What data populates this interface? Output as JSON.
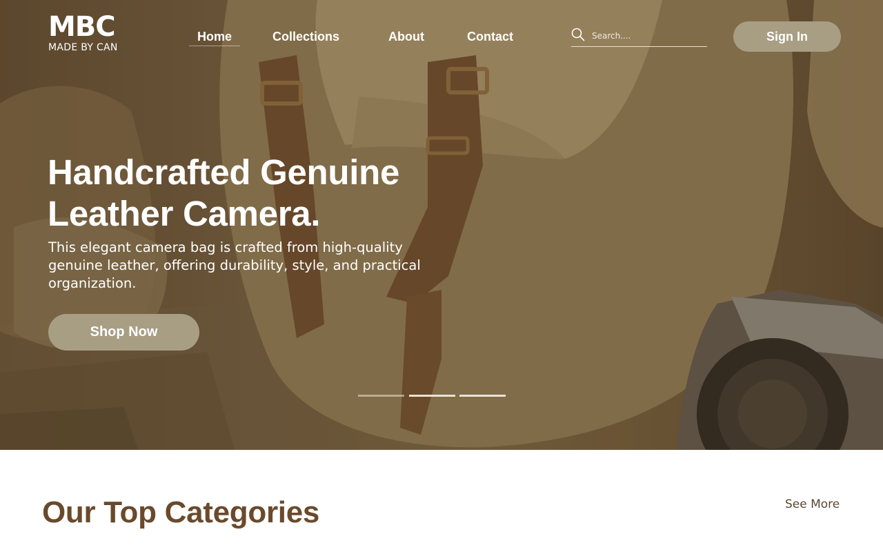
{
  "brand": {
    "logo_main": "MBC",
    "logo_sub": "MADE BY CAN"
  },
  "nav": {
    "items": [
      {
        "label": "Home",
        "active": true
      },
      {
        "label": "Collections",
        "active": false
      },
      {
        "label": "About",
        "active": false
      },
      {
        "label": "Contact",
        "active": false
      }
    ],
    "search_placeholder": "Search....",
    "search_icon": "search-icon",
    "signin_label": "Sign In"
  },
  "hero": {
    "headline": "Handcrafted Genuine Leather Camera.",
    "description": "This elegant camera bag is crafted from high-quality genuine leather, offering durability, style, and practical organization.",
    "cta_label": "Shop Now",
    "slides_total": 3,
    "active_slide": 2
  },
  "categories": {
    "title": "Our Top Categories",
    "see_more_label": "See More"
  },
  "colors": {
    "button_bg": "#a89e84",
    "heading_brown": "#6a4a2c",
    "link_brown": "#5b4630"
  }
}
